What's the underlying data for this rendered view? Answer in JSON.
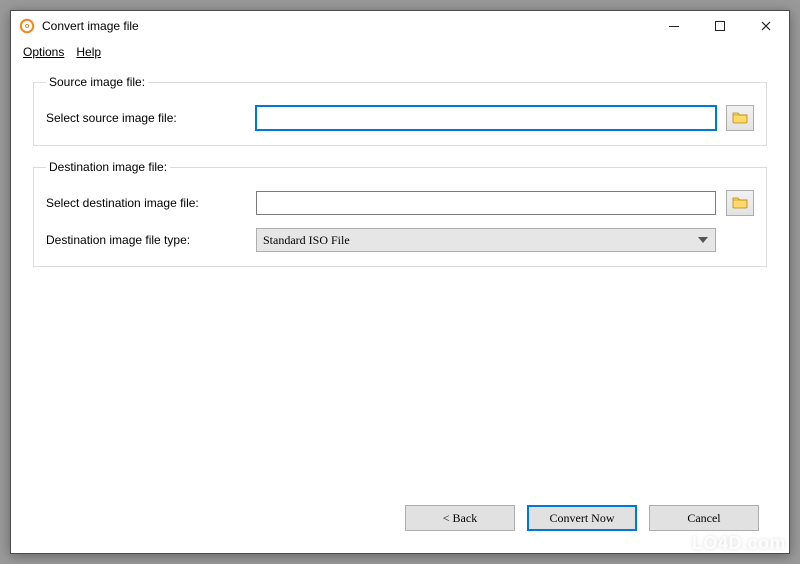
{
  "window": {
    "title": "Convert image file"
  },
  "menu": {
    "options": "Options",
    "help": "Help"
  },
  "groups": {
    "source": {
      "legend": "Source image file:",
      "label": "Select source image file:",
      "value": ""
    },
    "dest": {
      "legend": "Destination image file:",
      "selectLabel": "Select destination image file:",
      "selectValue": "",
      "typeLabel": "Destination image file type:",
      "typeValue": "Standard ISO File"
    }
  },
  "buttons": {
    "back": "< Back",
    "convert": "Convert Now",
    "cancel": "Cancel"
  },
  "watermark": "LO4D.com"
}
